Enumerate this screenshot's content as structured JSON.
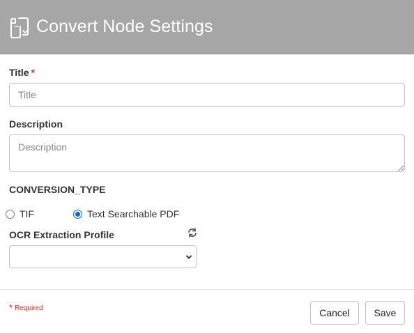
{
  "header": {
    "title": "Convert Node Settings",
    "icon": "convert-documents-icon",
    "background_color": "#a6a6a6"
  },
  "form": {
    "title_field": {
      "label": "Title",
      "required_marker": "*",
      "placeholder": "Title",
      "value": ""
    },
    "description_field": {
      "label": "Description",
      "placeholder": "Description",
      "value": ""
    },
    "conversion_type": {
      "label": "CONVERSION_TYPE",
      "options": [
        {
          "label": "TIF",
          "selected": false
        },
        {
          "label": "Text Searchable PDF",
          "selected": true
        }
      ]
    },
    "ocr_profile": {
      "label": "OCR Extraction Profile",
      "selected_value": "",
      "refresh_icon": "refresh-icon"
    }
  },
  "footer": {
    "required_note_star": "*",
    "required_note": "Required",
    "cancel_label": "Cancel",
    "save_label": "Save"
  },
  "colors": {
    "required": "#d9312b",
    "radio_selected": "#0a68d6"
  }
}
